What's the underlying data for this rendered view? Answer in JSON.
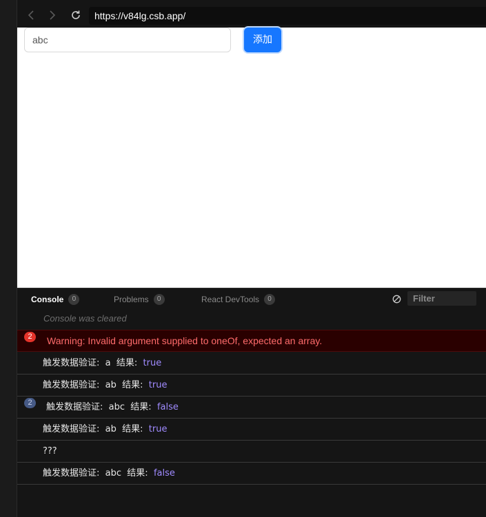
{
  "browser": {
    "url": "https://v84lg.csb.app/"
  },
  "preview": {
    "input_value": "abc",
    "add_button_label": "添加",
    "accent_color": "#1677ff"
  },
  "console": {
    "tabs": [
      {
        "label": "Console",
        "count": "0"
      },
      {
        "label": "Problems",
        "count": "0"
      },
      {
        "label": "React DevTools",
        "count": "0"
      }
    ],
    "filter_placeholder": "Filter",
    "cleared_text": "Console was cleared",
    "warning": {
      "badge": "2",
      "text": "Warning: Invalid argument supplied to oneOf, expected an array."
    },
    "logs": [
      {
        "label": "触发数据验证:",
        "input": "a",
        "result_label": "结果:",
        "result": "true"
      },
      {
        "label": "触发数据验证:",
        "input": "ab",
        "result_label": "结果:",
        "result": "true"
      },
      {
        "badge": "2",
        "label": "触发数据验证:",
        "input": "abc",
        "result_label": "结果:",
        "result": "false"
      },
      {
        "label": "触发数据验证:",
        "input": "ab",
        "result_label": "结果:",
        "result": "true"
      },
      {
        "text": "???"
      },
      {
        "label": "触发数据验证:",
        "input": "abc",
        "result_label": "结果:",
        "result": "false"
      }
    ]
  }
}
